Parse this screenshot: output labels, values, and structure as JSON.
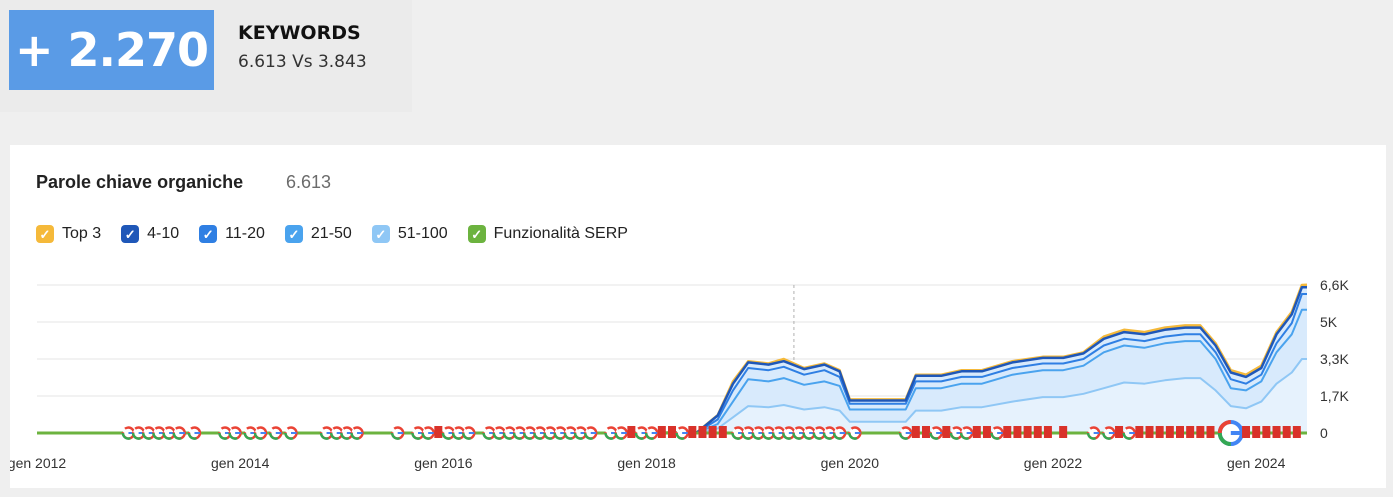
{
  "summary": {
    "delta": "+ 2.270",
    "label": "KEYWORDS",
    "comparison": "6.613 Vs 3.843"
  },
  "card": {
    "title": "Parole chiave organiche",
    "count": "6.613"
  },
  "legend": [
    {
      "label": "Top 3",
      "color": "#f5b93a"
    },
    {
      "label": "4-10",
      "color": "#1f57b8"
    },
    {
      "label": "11-20",
      "color": "#2f7fe3"
    },
    {
      "label": "21-50",
      "color": "#4aa3ee"
    },
    {
      "label": "51-100",
      "color": "#8fc7f5"
    },
    {
      "label": "Funzionalità SERP",
      "color": "#6cb33f"
    }
  ],
  "chart_data": {
    "type": "area",
    "x": [
      2012.0,
      2012.5,
      2013.0,
      2013.5,
      2014.0,
      2014.5,
      2015.0,
      2015.5,
      2016.0,
      2016.5,
      2017.0,
      2017.5,
      2018.0,
      2018.5,
      2018.7,
      2018.85,
      2019.0,
      2019.2,
      2019.35,
      2019.55,
      2019.75,
      2019.9,
      2020.0,
      2020.2,
      2020.4,
      2020.55,
      2020.65,
      2020.9,
      2021.1,
      2021.3,
      2021.6,
      2021.9,
      2022.1,
      2022.3,
      2022.5,
      2022.7,
      2022.9,
      2023.1,
      2023.3,
      2023.45,
      2023.6,
      2023.75,
      2023.9,
      2024.05,
      2024.2,
      2024.35,
      2024.45,
      2024.5
    ],
    "series": [
      {
        "name": "Top 3",
        "values": [
          0,
          0,
          0,
          0,
          0,
          0,
          0,
          0,
          0,
          0,
          0,
          0,
          0,
          0.05,
          0.8,
          2.3,
          3.2,
          3.1,
          3.3,
          2.9,
          3.1,
          2.8,
          1.5,
          1.5,
          1.5,
          1.5,
          2.6,
          2.6,
          2.8,
          2.8,
          3.2,
          3.4,
          3.4,
          3.6,
          4.3,
          4.6,
          4.5,
          4.7,
          4.8,
          4.8,
          4.0,
          2.8,
          2.6,
          3.0,
          4.5,
          5.4,
          6.6,
          6.613
        ]
      },
      {
        "name": "4-10",
        "values": [
          0,
          0,
          0,
          0,
          0,
          0,
          0,
          0,
          0,
          0,
          0,
          0,
          0,
          0.04,
          0.78,
          2.2,
          3.15,
          3.05,
          3.2,
          2.85,
          3.05,
          2.75,
          1.45,
          1.45,
          1.45,
          1.45,
          2.55,
          2.55,
          2.75,
          2.75,
          3.15,
          3.35,
          3.35,
          3.55,
          4.2,
          4.5,
          4.4,
          4.6,
          4.7,
          4.7,
          3.9,
          2.7,
          2.5,
          2.9,
          4.4,
          5.3,
          6.5,
          6.5
        ]
      },
      {
        "name": "11-20",
        "values": [
          0,
          0,
          0,
          0,
          0,
          0,
          0,
          0,
          0,
          0,
          0,
          0,
          0,
          0.03,
          0.6,
          1.9,
          2.9,
          2.8,
          2.95,
          2.6,
          2.8,
          2.5,
          1.3,
          1.3,
          1.3,
          1.3,
          2.3,
          2.3,
          2.5,
          2.5,
          2.9,
          3.1,
          3.1,
          3.3,
          3.9,
          4.2,
          4.1,
          4.3,
          4.4,
          4.4,
          3.6,
          2.4,
          2.2,
          2.6,
          4.0,
          4.9,
          6.2,
          6.2
        ]
      },
      {
        "name": "21-50",
        "values": [
          0,
          0,
          0,
          0,
          0,
          0,
          0,
          0,
          0,
          0,
          0,
          0,
          0,
          0.02,
          0.4,
          1.4,
          2.4,
          2.3,
          2.45,
          2.15,
          2.3,
          2.1,
          1.05,
          1.05,
          1.05,
          1.05,
          2.0,
          2.0,
          2.2,
          2.2,
          2.6,
          2.8,
          2.8,
          3.0,
          3.6,
          3.9,
          3.8,
          4.0,
          4.1,
          4.1,
          3.3,
          2.0,
          1.9,
          2.3,
          3.6,
          4.4,
          5.5,
          5.5
        ]
      },
      {
        "name": "51-100",
        "values": [
          0,
          0,
          0,
          0,
          0,
          0,
          0,
          0,
          0,
          0,
          0,
          0,
          0,
          0.01,
          0.2,
          0.7,
          1.2,
          1.15,
          1.25,
          1.05,
          1.15,
          1.0,
          0.5,
          0.5,
          0.5,
          0.5,
          1.0,
          1.0,
          1.15,
          1.15,
          1.4,
          1.6,
          1.6,
          1.75,
          2.0,
          2.25,
          2.2,
          2.35,
          2.45,
          2.45,
          1.9,
          1.2,
          1.1,
          1.4,
          2.2,
          2.7,
          3.3,
          3.3
        ]
      }
    ],
    "x_ticks": [
      "gen 2012",
      "gen 2014",
      "gen 2016",
      "gen 2018",
      "gen 2020",
      "gen 2022",
      "gen 2024"
    ],
    "y_ticks": [
      "0",
      "1,7K",
      "3,3K",
      "5K",
      "6,6K"
    ],
    "y_tick_values": [
      0,
      1.65,
      3.3,
      4.95,
      6.6
    ],
    "ylim": [
      0,
      6.6
    ],
    "xlim": [
      2012.0,
      2024.5
    ],
    "grid": true,
    "legend_position": "top-left"
  },
  "serp_markers": [
    {
      "x": 2012.9,
      "icon": "google-g-icon"
    },
    {
      "x": 2013.0,
      "icon": "google-g-icon"
    },
    {
      "x": 2013.1,
      "icon": "google-g-icon"
    },
    {
      "x": 2013.2,
      "icon": "google-g-icon"
    },
    {
      "x": 2013.3,
      "icon": "google-g-icon"
    },
    {
      "x": 2013.4,
      "icon": "google-g-icon"
    },
    {
      "x": 2013.55,
      "icon": "google-g-icon"
    },
    {
      "x": 2013.85,
      "icon": "google-g-icon"
    },
    {
      "x": 2013.95,
      "icon": "google-g-icon"
    },
    {
      "x": 2014.1,
      "icon": "google-g-icon"
    },
    {
      "x": 2014.2,
      "icon": "google-g-icon"
    },
    {
      "x": 2014.35,
      "icon": "google-g-icon"
    },
    {
      "x": 2014.5,
      "icon": "google-g-icon"
    },
    {
      "x": 2014.85,
      "icon": "google-g-icon"
    },
    {
      "x": 2014.95,
      "icon": "google-g-icon"
    },
    {
      "x": 2015.05,
      "icon": "google-g-icon"
    },
    {
      "x": 2015.15,
      "icon": "google-g-icon"
    },
    {
      "x": 2015.55,
      "icon": "google-g-icon"
    },
    {
      "x": 2015.75,
      "icon": "google-g-icon"
    },
    {
      "x": 2015.85,
      "icon": "google-g-icon"
    },
    {
      "x": 2015.95,
      "icon": "red-flag-icon"
    },
    {
      "x": 2016.05,
      "icon": "google-g-icon"
    },
    {
      "x": 2016.15,
      "icon": "google-g-icon"
    },
    {
      "x": 2016.25,
      "icon": "google-g-icon"
    },
    {
      "x": 2016.45,
      "icon": "google-g-icon"
    },
    {
      "x": 2016.55,
      "icon": "google-g-icon"
    },
    {
      "x": 2016.65,
      "icon": "google-g-icon"
    },
    {
      "x": 2016.75,
      "icon": "google-g-icon"
    },
    {
      "x": 2016.85,
      "icon": "google-g-icon"
    },
    {
      "x": 2016.95,
      "icon": "google-g-icon"
    },
    {
      "x": 2017.05,
      "icon": "google-g-icon"
    },
    {
      "x": 2017.15,
      "icon": "google-g-icon"
    },
    {
      "x": 2017.25,
      "icon": "google-g-icon"
    },
    {
      "x": 2017.35,
      "icon": "google-g-icon"
    },
    {
      "x": 2017.45,
      "icon": "google-g-icon"
    },
    {
      "x": 2017.65,
      "icon": "google-g-icon"
    },
    {
      "x": 2017.75,
      "icon": "google-g-icon"
    },
    {
      "x": 2017.85,
      "icon": "red-flag-icon"
    },
    {
      "x": 2017.95,
      "icon": "google-g-icon"
    },
    {
      "x": 2018.05,
      "icon": "google-g-icon"
    },
    {
      "x": 2018.15,
      "icon": "red-flag-icon"
    },
    {
      "x": 2018.25,
      "icon": "red-flag-icon"
    },
    {
      "x": 2018.35,
      "icon": "google-g-icon"
    },
    {
      "x": 2018.45,
      "icon": "red-flag-icon"
    },
    {
      "x": 2018.55,
      "icon": "red-flag-icon"
    },
    {
      "x": 2018.65,
      "icon": "red-flag-icon"
    },
    {
      "x": 2018.75,
      "icon": "red-flag-icon"
    },
    {
      "x": 2018.9,
      "icon": "google-g-icon"
    },
    {
      "x": 2019.0,
      "icon": "google-g-icon"
    },
    {
      "x": 2019.1,
      "icon": "google-g-icon"
    },
    {
      "x": 2019.2,
      "icon": "google-g-icon"
    },
    {
      "x": 2019.3,
      "icon": "google-g-icon"
    },
    {
      "x": 2019.4,
      "icon": "google-g-icon"
    },
    {
      "x": 2019.5,
      "icon": "google-g-icon"
    },
    {
      "x": 2019.6,
      "icon": "google-g-icon"
    },
    {
      "x": 2019.7,
      "icon": "google-g-icon"
    },
    {
      "x": 2019.8,
      "icon": "google-g-icon"
    },
    {
      "x": 2019.9,
      "icon": "google-g-icon"
    },
    {
      "x": 2020.05,
      "icon": "google-g-icon"
    },
    {
      "x": 2020.55,
      "icon": "google-g-icon"
    },
    {
      "x": 2020.65,
      "icon": "red-flag-icon"
    },
    {
      "x": 2020.75,
      "icon": "red-flag-icon"
    },
    {
      "x": 2020.85,
      "icon": "google-g-icon"
    },
    {
      "x": 2020.95,
      "icon": "red-flag-icon"
    },
    {
      "x": 2021.05,
      "icon": "google-g-icon"
    },
    {
      "x": 2021.15,
      "icon": "google-g-icon"
    },
    {
      "x": 2021.25,
      "icon": "red-flag-icon"
    },
    {
      "x": 2021.35,
      "icon": "red-flag-icon"
    },
    {
      "x": 2021.45,
      "icon": "google-g-icon"
    },
    {
      "x": 2021.55,
      "icon": "red-flag-icon"
    },
    {
      "x": 2021.65,
      "icon": "red-flag-icon"
    },
    {
      "x": 2021.75,
      "icon": "red-flag-icon"
    },
    {
      "x": 2021.85,
      "icon": "red-flag-icon"
    },
    {
      "x": 2021.95,
      "icon": "red-flag-icon"
    },
    {
      "x": 2022.1,
      "icon": "red-flag-icon"
    },
    {
      "x": 2022.4,
      "icon": "google-g-icon"
    },
    {
      "x": 2022.55,
      "icon": "google-g-icon"
    },
    {
      "x": 2022.65,
      "icon": "red-flag-icon"
    },
    {
      "x": 2022.75,
      "icon": "google-g-icon"
    },
    {
      "x": 2022.85,
      "icon": "red-flag-icon"
    },
    {
      "x": 2022.95,
      "icon": "red-flag-icon"
    },
    {
      "x": 2023.05,
      "icon": "red-flag-icon"
    },
    {
      "x": 2023.15,
      "icon": "red-flag-icon"
    },
    {
      "x": 2023.25,
      "icon": "red-flag-icon"
    },
    {
      "x": 2023.35,
      "icon": "red-flag-icon"
    },
    {
      "x": 2023.45,
      "icon": "red-flag-icon"
    },
    {
      "x": 2023.55,
      "icon": "red-flag-icon"
    },
    {
      "x": 2023.75,
      "icon": "google-g-large-icon"
    },
    {
      "x": 2023.9,
      "icon": "red-flag-icon"
    },
    {
      "x": 2024.0,
      "icon": "red-flag-icon"
    },
    {
      "x": 2024.1,
      "icon": "red-flag-icon"
    },
    {
      "x": 2024.2,
      "icon": "red-flag-icon"
    },
    {
      "x": 2024.3,
      "icon": "red-flag-icon"
    },
    {
      "x": 2024.4,
      "icon": "red-flag-icon"
    }
  ],
  "hover_line_x": 2019.45
}
